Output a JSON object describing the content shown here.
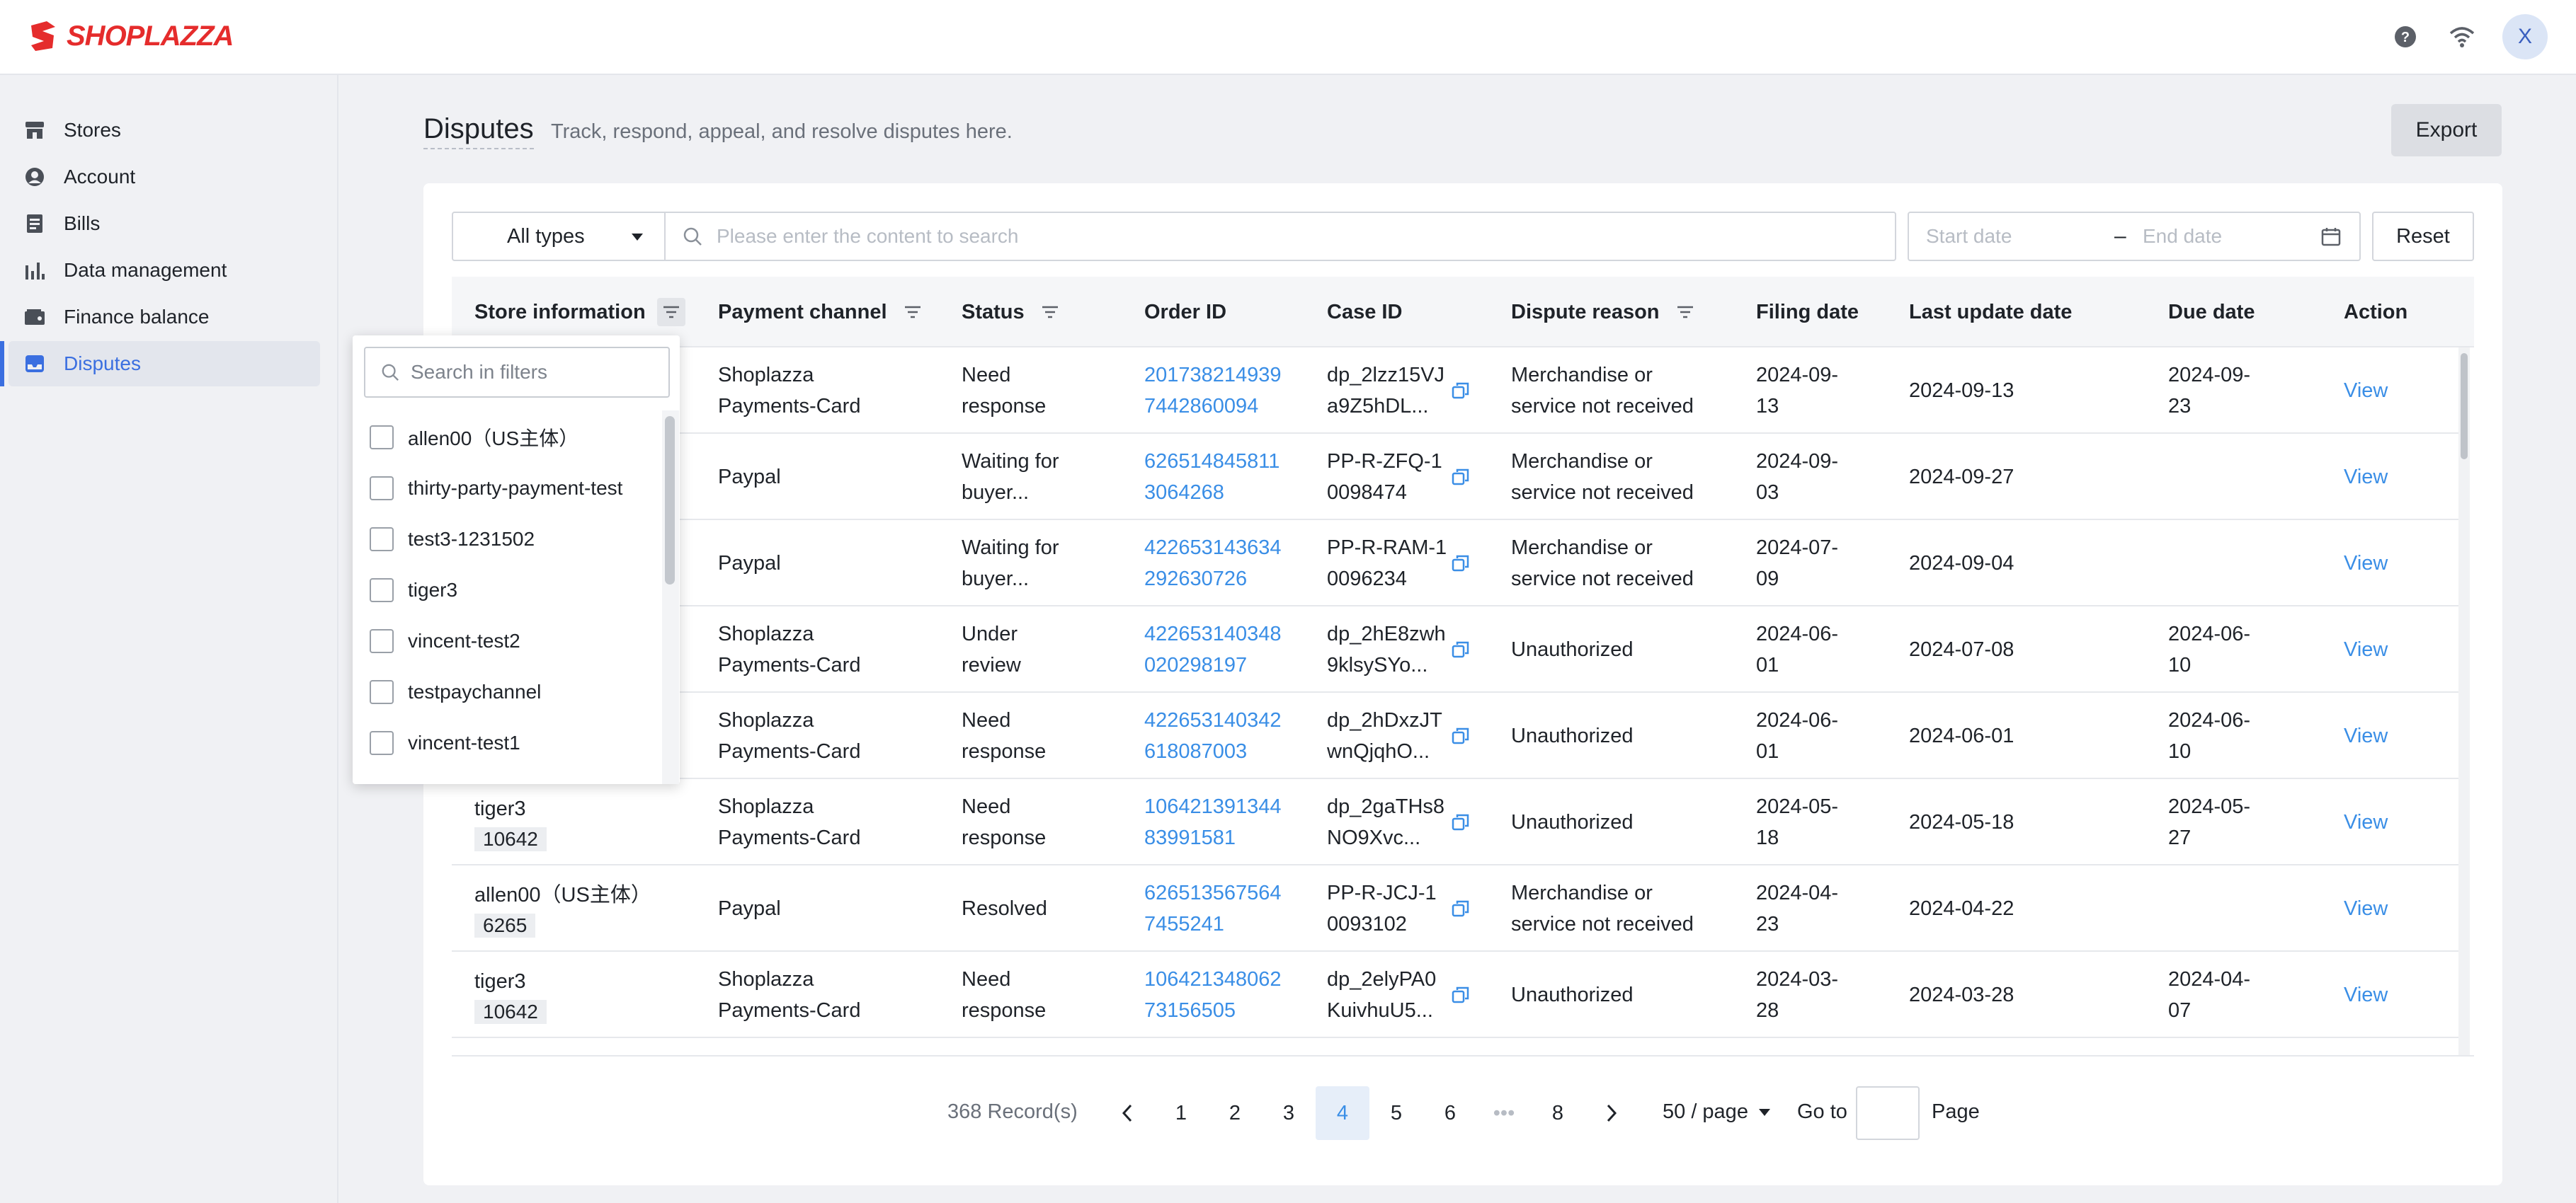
{
  "brand": {
    "name": "SHOPLAZZA",
    "color": "#e52c2c"
  },
  "topbar": {
    "help_icon": "help-circle-icon",
    "wifi_icon": "wifi-icon",
    "avatar_initial": "X"
  },
  "sidebar": {
    "items": [
      {
        "label": "Stores",
        "icon": "store-icon",
        "active": false
      },
      {
        "label": "Account",
        "icon": "user-circle-icon",
        "active": false
      },
      {
        "label": "Bills",
        "icon": "bill-icon",
        "active": false
      },
      {
        "label": "Data management",
        "icon": "bar-chart-icon",
        "active": false
      },
      {
        "label": "Finance balance",
        "icon": "wallet-icon",
        "active": false
      },
      {
        "label": "Disputes",
        "icon": "inbox-icon",
        "active": true
      }
    ]
  },
  "header": {
    "title": "Disputes",
    "subtitle": "Track, respond, appeal, and resolve disputes here.",
    "export_label": "Export"
  },
  "filters": {
    "type_value": "All types",
    "search_placeholder": "Please enter the content to search",
    "start_placeholder": "Start date",
    "end_placeholder": "End date",
    "reset_label": "Reset"
  },
  "table": {
    "columns": [
      "Store information",
      "Payment channel",
      "Status",
      "Order ID",
      "Case ID",
      "Dispute reason",
      "Filing date",
      "Last update date",
      "Due date",
      "Action"
    ],
    "rows": [
      {
        "store": "",
        "store_id": "",
        "channel": "Shoplazza Payments-Card",
        "status": "Need response",
        "order": "2017382149397442860094",
        "case": "dp_2lzz15VJa9Z5hDL...",
        "reason": "Merchandise or service not received",
        "filing": "2024-09-13",
        "updated": "2024-09-13",
        "due": "2024-09-23",
        "action": "View"
      },
      {
        "store": "",
        "store_id": "",
        "channel": "Paypal",
        "status": "Waiting for buyer...",
        "order": "6265148458113064268",
        "case": "PP-R-ZFQ-10098474",
        "reason": "Merchandise or service not received",
        "filing": "2024-09-03",
        "updated": "2024-09-27",
        "due": "",
        "action": "View"
      },
      {
        "store": "",
        "store_id": "",
        "channel": "Paypal",
        "status": "Waiting for buyer...",
        "order": "422653143634292630726",
        "case": "PP-R-RAM-10096234",
        "reason": "Merchandise or service not received",
        "filing": "2024-07-09",
        "updated": "2024-09-04",
        "due": "",
        "action": "View"
      },
      {
        "store": "",
        "store_id": "",
        "channel": "Shoplazza Payments-Card",
        "status": "Under review",
        "order": "422653140348020298197",
        "case": "dp_2hE8zwh9klsySYo...",
        "reason": "Unauthorized",
        "filing": "2024-06-01",
        "updated": "2024-07-08",
        "due": "2024-06-10",
        "action": "View"
      },
      {
        "store": "",
        "store_id": "",
        "channel": "Shoplazza Payments-Card",
        "status": "Need response",
        "order": "422653140342618087003",
        "case": "dp_2hDxzJTwnQjqhO...",
        "reason": "Unauthorized",
        "filing": "2024-06-01",
        "updated": "2024-06-01",
        "due": "2024-06-10",
        "action": "View"
      },
      {
        "store": "tiger3",
        "store_id": "10642",
        "channel": "Shoplazza Payments-Card",
        "status": "Need response",
        "order": "10642139134483991581",
        "case": "dp_2gaTHs8NO9Xvc...",
        "reason": "Unauthorized",
        "filing": "2024-05-18",
        "updated": "2024-05-18",
        "due": "2024-05-27",
        "action": "View"
      },
      {
        "store": "allen00（US主体）",
        "store_id": "6265",
        "channel": "Paypal",
        "status": "Resolved",
        "order": "6265135675647455241",
        "case": "PP-R-JCJ-10093102",
        "reason": "Merchandise or service not received",
        "filing": "2024-04-23",
        "updated": "2024-04-22",
        "due": "",
        "action": "View"
      },
      {
        "store": "tiger3",
        "store_id": "10642",
        "channel": "Shoplazza Payments-Card",
        "status": "Need response",
        "order": "10642134806273156505",
        "case": "dp_2elyPA0KuivhuU5...",
        "reason": "Unauthorized",
        "filing": "2024-03-28",
        "updated": "2024-03-28",
        "due": "2024-04-07",
        "action": "View"
      }
    ]
  },
  "pagination": {
    "total": "368 Record(s)",
    "pages": [
      "1",
      "2",
      "3",
      "4",
      "5",
      "6",
      "•••",
      "8"
    ],
    "current": "4",
    "page_size": "50 / page",
    "goto_label": "Go to",
    "page_label": "Page"
  },
  "store_filter": {
    "search_placeholder": "Search in filters",
    "options": [
      "allen00（US主体）",
      "thirty-party-payment-test",
      "test3-1231502",
      "tiger3",
      "vincent-test2",
      "testpaychannel",
      "vincent-test1"
    ]
  },
  "colors": {
    "link": "#3a8ee6",
    "active_nav": "#3b6fe0"
  }
}
